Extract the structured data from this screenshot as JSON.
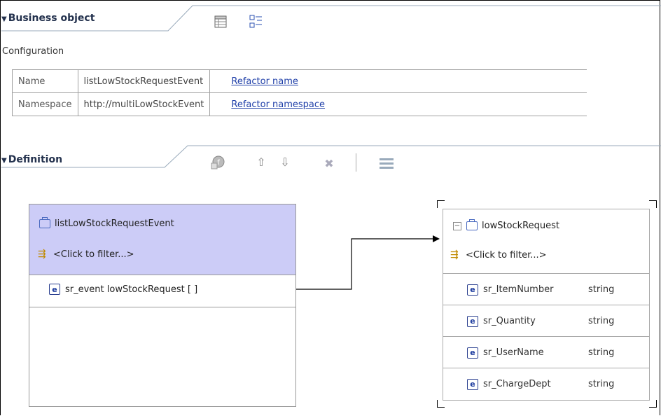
{
  "business_object": {
    "title": "Business object",
    "configuration_label": "Configuration",
    "rows": [
      {
        "label": "Name",
        "value": "listLowStockRequestEvent",
        "link": "Refactor name"
      },
      {
        "label": "Namespace",
        "value": "http://multiLowStockEvent",
        "link": "Refactor namespace"
      }
    ],
    "icons": [
      "table-view-icon",
      "tree-view-icon"
    ]
  },
  "definition": {
    "title": "Definition",
    "icons": [
      "add-field-icon",
      "move-up-icon",
      "move-down-icon",
      "delete-icon",
      "separator",
      "layout-icon"
    ],
    "move_up_glyph": "⇧",
    "move_down_glyph": "⇩",
    "delete_glyph": "✖",
    "source": {
      "name": "listLowStockRequestEvent",
      "filter": "<Click to filter...>",
      "field": "sr_event lowStockRequest [ ]"
    },
    "target": {
      "name": "lowStockRequest",
      "filter": "<Click to filter...>",
      "fields": [
        {
          "name": "sr_ItemNumber",
          "type": "string"
        },
        {
          "name": "sr_Quantity",
          "type": "string"
        },
        {
          "name": "sr_UserName",
          "type": "string"
        },
        {
          "name": "sr_ChargeDept",
          "type": "string"
        }
      ]
    }
  },
  "colors": {
    "header_bg": "#ccccf7",
    "link": "#1f3fa8",
    "title": "#23314d"
  }
}
